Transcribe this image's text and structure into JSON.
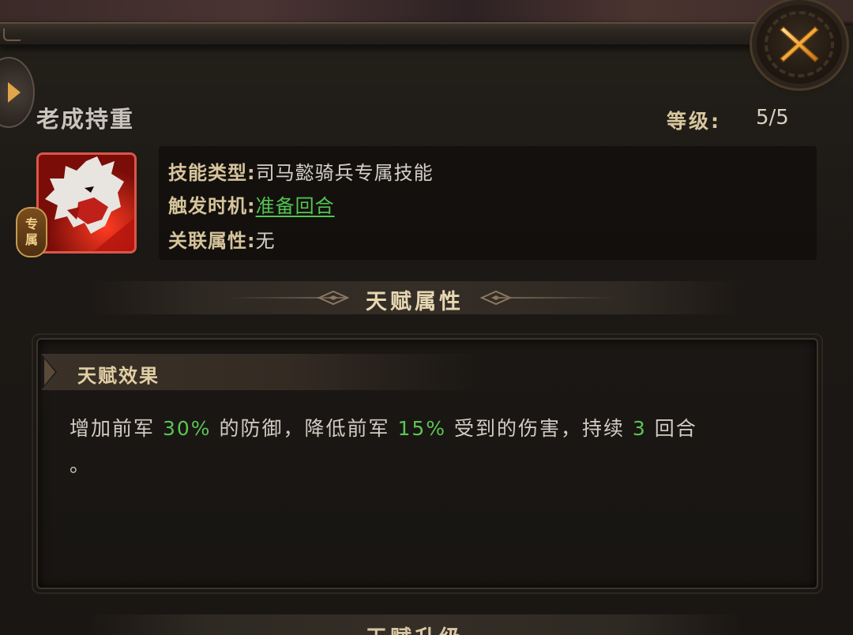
{
  "skill": {
    "name": "老成持重",
    "level_label": "等级:",
    "level_value": "5/5",
    "exclusive_badge": [
      "专",
      "属"
    ]
  },
  "info": {
    "skill_type_key": "技能类型:",
    "skill_type_value": "司马懿骑兵专属技能",
    "trigger_key": "触发时机:",
    "trigger_value": "准备回合",
    "attribute_key": "关联属性:",
    "attribute_value": "无"
  },
  "section": {
    "talent_attributes": "天赋属性",
    "talent_upgrade": "天赋升级"
  },
  "effect": {
    "title": "天赋效果",
    "text_1": "增加前军 ",
    "num_1": "30%",
    "text_2": " 的防御，降低前军 ",
    "num_2": "15%",
    "text_3": " 受到的伤害，持续 ",
    "num_3": "3",
    "text_4": " 回合",
    "text_5": "。"
  },
  "colors": {
    "highlight_green": "#5bc455",
    "label_gold": "#d6c49b",
    "icon_border_red": "#d9574a"
  },
  "icons": {
    "close": "close-x-icon",
    "side_arrow": "triangle-right-icon",
    "skill": "red-dragon-head-icon"
  }
}
